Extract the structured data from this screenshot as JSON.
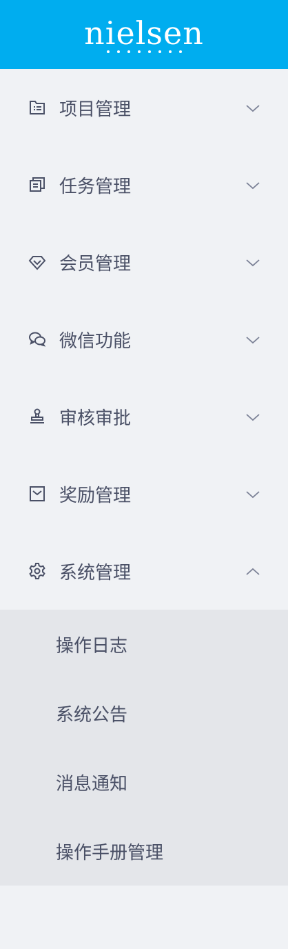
{
  "logo": {
    "text": "nielsen",
    "icon": "nielsen-logo"
  },
  "colors": {
    "header_bg": "#00adef",
    "sidebar_bg": "#f0f2f5",
    "submenu_bg": "#e4e6ea",
    "text": "#4a5066"
  },
  "menu": [
    {
      "label": "项目管理",
      "icon": "project-icon",
      "expanded": false
    },
    {
      "label": "任务管理",
      "icon": "task-icon",
      "expanded": false
    },
    {
      "label": "会员管理",
      "icon": "diamond-icon",
      "expanded": false
    },
    {
      "label": "微信功能",
      "icon": "wechat-icon",
      "expanded": false
    },
    {
      "label": "审核审批",
      "icon": "stamp-icon",
      "expanded": false
    },
    {
      "label": "奖励管理",
      "icon": "reward-icon",
      "expanded": false
    },
    {
      "label": "系统管理",
      "icon": "gear-icon",
      "expanded": true,
      "children": [
        "操作日志",
        "系统公告",
        "消息通知",
        "操作手册管理"
      ]
    }
  ]
}
